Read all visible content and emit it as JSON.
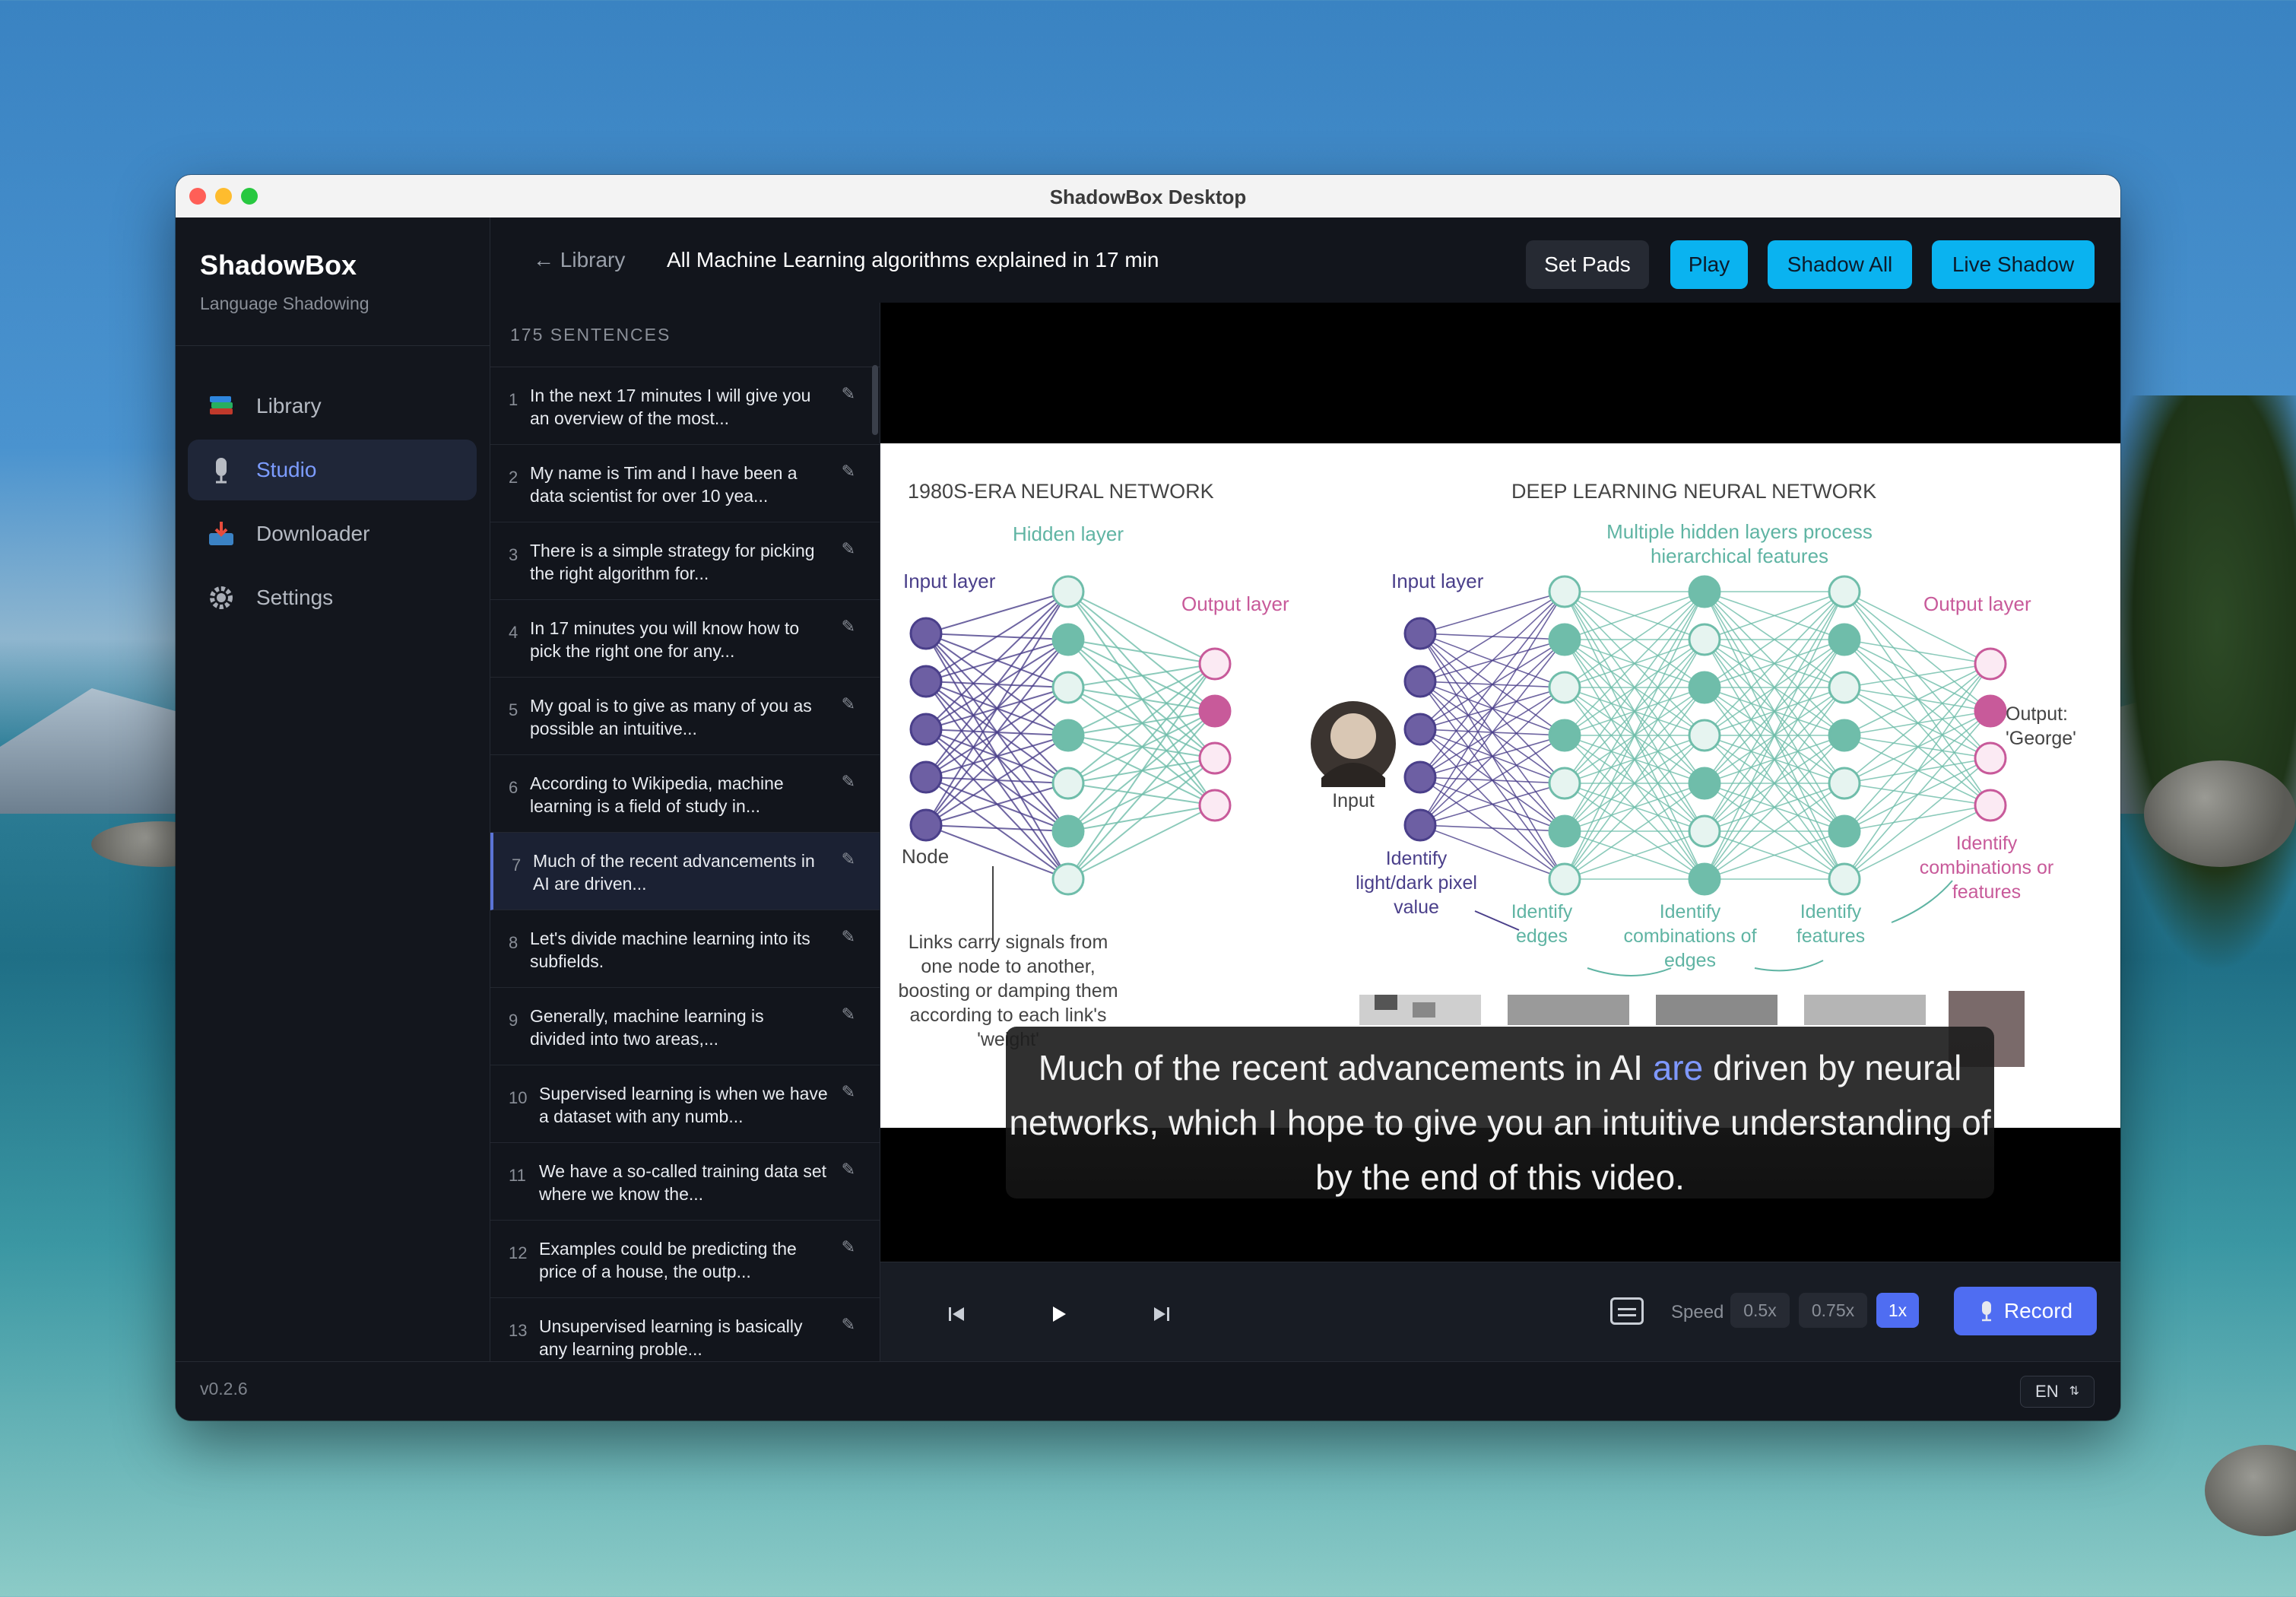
{
  "window": {
    "title": "ShadowBox Desktop"
  },
  "sidebar": {
    "brand": "ShadowBox",
    "subtitle": "Language Shadowing",
    "items": [
      {
        "label": "Library",
        "icon": "books-icon",
        "active": false
      },
      {
        "label": "Studio",
        "icon": "microphone-icon",
        "active": true
      },
      {
        "label": "Downloader",
        "icon": "inbox-tray-icon",
        "active": false
      },
      {
        "label": "Settings",
        "icon": "gear-icon",
        "active": false
      }
    ],
    "version": "v0.2.6"
  },
  "footer": {
    "language": "EN"
  },
  "header": {
    "back_label": "← Library",
    "title": "All Machine Learning algorithms explained in 17 min",
    "buttons": {
      "set_pads": "Set Pads",
      "play": "Play",
      "shadow_all": "Shadow All",
      "live_shadow": "Live Shadow"
    }
  },
  "sentences": {
    "count_label": "175 SENTENCES",
    "items": [
      {
        "num": "1",
        "text": "In the next 17 minutes I will give you an overview of the most..."
      },
      {
        "num": "2",
        "text": "My name is Tim and I have been a data scientist for over 10 yea..."
      },
      {
        "num": "3",
        "text": "There is a simple strategy for picking the right algorithm for..."
      },
      {
        "num": "4",
        "text": "In 17 minutes you will know how to pick the right one for any..."
      },
      {
        "num": "5",
        "text": "My goal is to give as many of you as possible an intuitive..."
      },
      {
        "num": "6",
        "text": "According to Wikipedia, machine learning is a field of study in..."
      },
      {
        "num": "7",
        "text": "Much of the recent advancements in AI are driven...",
        "active": true
      },
      {
        "num": "8",
        "text": "Let's divide machine learning into its subfields."
      },
      {
        "num": "9",
        "text": "Generally, machine learning is divided into two areas,..."
      },
      {
        "num": "10",
        "text": "Supervised learning is when we have a dataset with any numb..."
      },
      {
        "num": "11",
        "text": "We have a so-called training data set where we know the..."
      },
      {
        "num": "12",
        "text": "Examples could be predicting the price of a house, the outp..."
      },
      {
        "num": "13",
        "text": "Unsupervised learning is basically any learning proble..."
      }
    ]
  },
  "video": {
    "slide": {
      "left_title": "1980S-ERA NEURAL NETWORK",
      "right_title": "DEEP LEARNING NEURAL NETWORK",
      "labels": {
        "hidden_layer": "Hidden layer",
        "input_layer": "Input layer",
        "output_layer": "Output layer",
        "node": "Node",
        "links": "Links carry signals from one node to another, boosting or damping them according to each link's 'weight'",
        "multiple_hidden": "Multiple hidden layers process hierarchical features",
        "input": "Input",
        "output_george": "Output: 'George'",
        "identify_pixel": "Identify light/dark pixel value",
        "identify_edges": "Identify edges",
        "identify_comb_edges": "Identify combinations of edges",
        "identify_features": "Identify features",
        "identify_comb_features": "Identify combinations or features"
      }
    },
    "caption": {
      "before": "Much of the recent advancements in AI ",
      "highlight": "are",
      "after": " driven by neural networks, which I hope to give you an intuitive understanding of by the end of this video."
    }
  },
  "player": {
    "speed_label": "Speed",
    "speeds": [
      "0.5x",
      "0.75x",
      "1x"
    ],
    "active_speed": "1x",
    "record_label": "Record"
  },
  "colors": {
    "accent": "#4f6df2",
    "cyan": "#0ab3f0",
    "purple_node": "#6d5fa3",
    "teal_node": "#6fbdaa",
    "pink_node": "#c85a9a"
  }
}
